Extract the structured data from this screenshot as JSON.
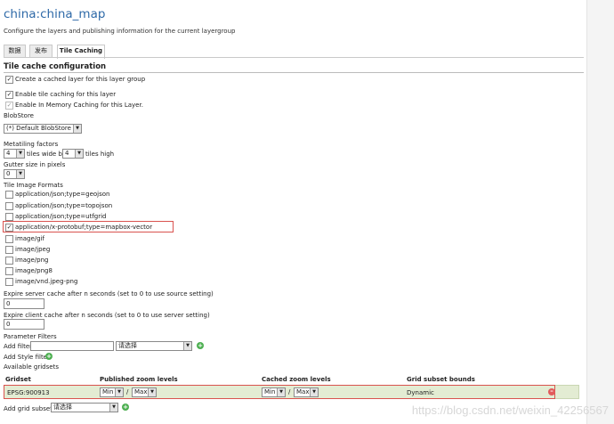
{
  "page": {
    "title": "china:china_map",
    "subtitle": "Configure the layers and publishing information for the current layergroup"
  },
  "tabs": [
    {
      "label": "数据"
    },
    {
      "label": "发布"
    },
    {
      "label": "Tile Caching"
    }
  ],
  "tile_cache": {
    "section_title": "Tile cache configuration",
    "create_cached_layer": {
      "label": "Create a cached layer for this layer group",
      "checked": true
    },
    "enable_tile_caching": {
      "label": "Enable tile caching for this layer",
      "checked": true
    },
    "enable_in_memory": {
      "label": "Enable In Memory Caching for this Layer.",
      "checked": true
    },
    "blobstore_label": "BlobStore",
    "blobstore_value": "(*) Default BlobStore",
    "metatiling_label": "Metatiling factors",
    "metatile_wide_value": "4",
    "tiles_wide_by": "tiles wide by",
    "metatile_high_value": "4",
    "tiles_high": "tiles high",
    "gutter_label": "Gutter size in pixels",
    "gutter_value": "0",
    "formats_label": "Tile Image Formats",
    "formats": [
      {
        "label": "application/json;type=geojson",
        "checked": false
      },
      {
        "label": "application/json;type=topojson",
        "checked": false
      },
      {
        "label": "application/json;type=utfgrid",
        "checked": false
      },
      {
        "label": "application/x-protobuf;type=mapbox-vector",
        "checked": true
      },
      {
        "label": "image/gif",
        "checked": false
      },
      {
        "label": "image/jpeg",
        "checked": false
      },
      {
        "label": "image/png",
        "checked": false
      },
      {
        "label": "image/png8",
        "checked": false
      },
      {
        "label": "image/vnd.jpeg-png",
        "checked": false
      }
    ],
    "expire_server_label": "Expire server cache after n seconds (set to 0 to use source setting)",
    "expire_server_value": "0",
    "expire_client_label": "Expire client cache after n seconds (set to 0 to use server setting)",
    "expire_client_value": "0",
    "parameter_filters_label": "Parameter Filters",
    "add_filter_label": "Add filter",
    "add_filter_input": "",
    "add_filter_select": "请选择",
    "add_style_filter_label": "Add Style filter",
    "available_gridsets_label": "Available gridsets"
  },
  "gridsets": {
    "headers": {
      "gridset": "Gridset",
      "published": "Published zoom levels",
      "cached": "Cached zoom levels",
      "bounds": "Grid subset bounds"
    },
    "rows": [
      {
        "name": "EPSG:900913",
        "published_min": "Min",
        "published_max": "Max",
        "cached_min": "Min",
        "cached_max": "Max",
        "slash": "/",
        "bounds": "Dynamic"
      }
    ],
    "add_grid_subset_label": "Add grid subset:",
    "add_grid_subset_select": "请选择"
  },
  "watermark": "https://blog.csdn.net/weixin_42256567",
  "colors": {
    "title": "#2f6aa8",
    "highlight": "#d9534f",
    "gridrow": "#e3ecd3",
    "add": "#4caf50",
    "remove": "#e25b5b"
  },
  "icons": {
    "add": "plus-circle-icon",
    "remove": "minus-circle-icon",
    "dropdown": "chevron-down-icon"
  }
}
